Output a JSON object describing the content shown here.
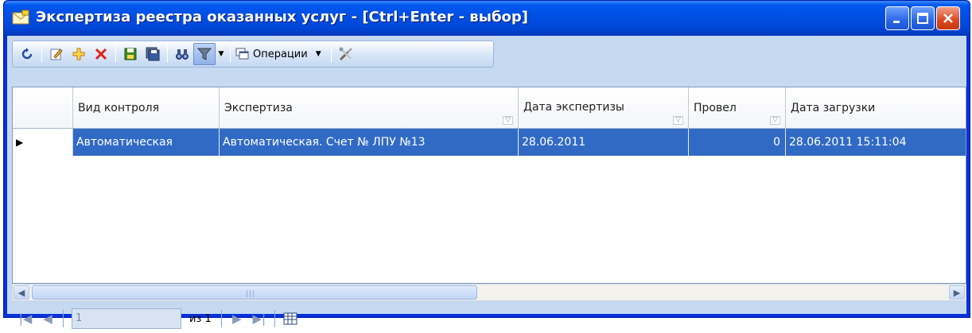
{
  "window": {
    "title": "Экспертиза реестра  оказанных услуг - [Ctrl+Enter - выбор]"
  },
  "toolbar": {
    "operations_label": "Операции"
  },
  "grid": {
    "columns": [
      "Вид контроля",
      "Экспертиза",
      "Дата экспертизы",
      "Провел",
      "Дата загрузки"
    ],
    "rows": [
      {
        "control_type": "Автоматическая",
        "expertise": "Автоматическая. Счет №  ЛПУ №13",
        "expertise_date": "28.06.2011",
        "performed_by": "0",
        "load_date": "28.06.2011 15:11:04"
      }
    ]
  },
  "navigator": {
    "current_page": "1",
    "page_of": "из 1"
  },
  "colors": {
    "title_bar": "#0054e3",
    "selection": "#316ac5",
    "client_bg": "#c5d9f1"
  }
}
